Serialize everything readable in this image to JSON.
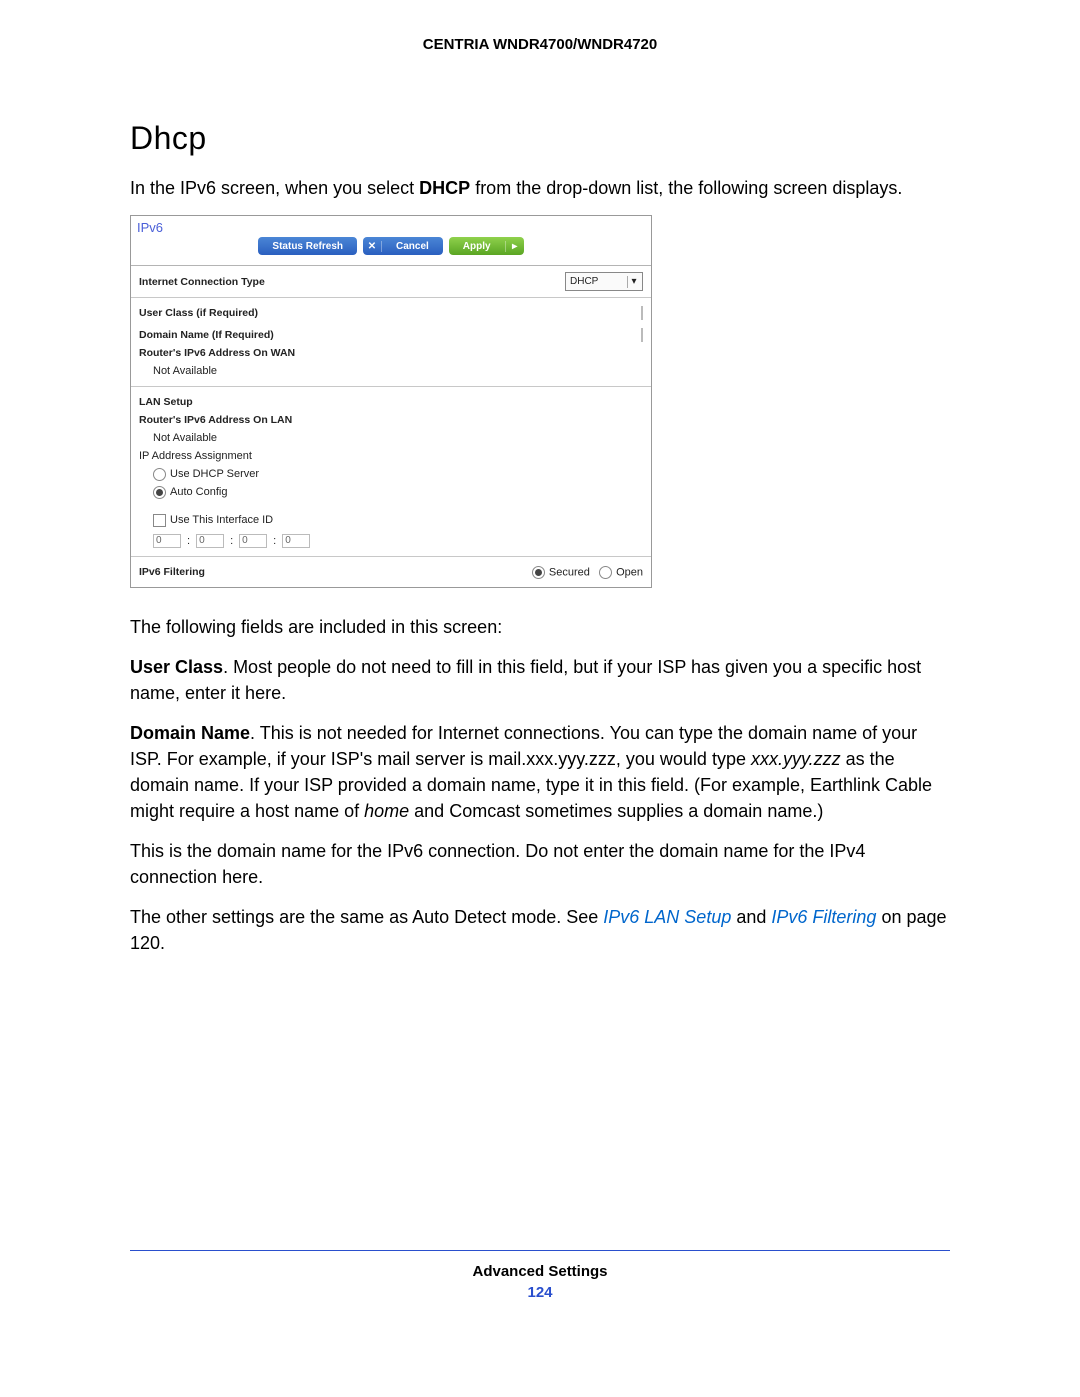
{
  "doc": {
    "product_header": "CENTRIA WNDR4700/WNDR4720",
    "section_title": "Dhcp",
    "intro_pre": "In the IPv6 screen, when you select ",
    "intro_bold": "DHCP",
    "intro_post": " from the drop-down list, the following screen displays.",
    "follow_line": "The following fields are included in this screen:",
    "userclass_label": "User Class",
    "userclass_text": ". Most people do not need to fill in this field, but if your ISP has given you a specific host name, enter it here.",
    "domain_label": "Domain Name",
    "domain_text1": ". This is not needed for Internet connections. You can type the domain name of your ISP. For example, if your ISP's mail server is mail.xxx.yyy.zzz, you would type ",
    "domain_ital": "xxx.yyy.zzz",
    "domain_text2": " as the domain name. If your ISP provided a domain name, type it in this field. (For example, Earthlink Cable might require a host name of ",
    "domain_ital2": "home",
    "domain_text3": " and Comcast sometimes supplies a domain name.)",
    "para4": "This is the domain name for the IPv6 connection. Do not enter the domain name for the IPv4 connection here.",
    "para5_pre": "The other settings are the same as Auto Detect mode. See ",
    "link1": "IPv6 LAN Setup",
    "para5_mid": "  and ",
    "link2": "IPv6 Filtering",
    "para5_post": " on page 120.",
    "footer_label": "Advanced Settings",
    "page_number": "124"
  },
  "screenshot": {
    "title": "IPv6",
    "btn_refresh": "Status Refresh",
    "btn_cancel": "Cancel",
    "btn_apply": "Apply",
    "conn_type_label": "Internet Connection Type",
    "conn_type_value": "DHCP",
    "user_class_label": "User Class (if Required)",
    "domain_name_label": "Domain Name  (If Required)",
    "wan_addr_label": "Router's IPv6 Address On WAN",
    "not_available": "Not Available",
    "lan_setup": "LAN Setup",
    "lan_addr_label": "Router's IPv6 Address On LAN",
    "ip_assign_label": "IP Address Assignment",
    "opt_dhcp": "Use DHCP Server",
    "opt_auto": "Auto Config",
    "use_interface": "Use This Interface ID",
    "iid_val": "0",
    "filtering_label": "IPv6 Filtering",
    "secured": "Secured",
    "open": "Open"
  }
}
